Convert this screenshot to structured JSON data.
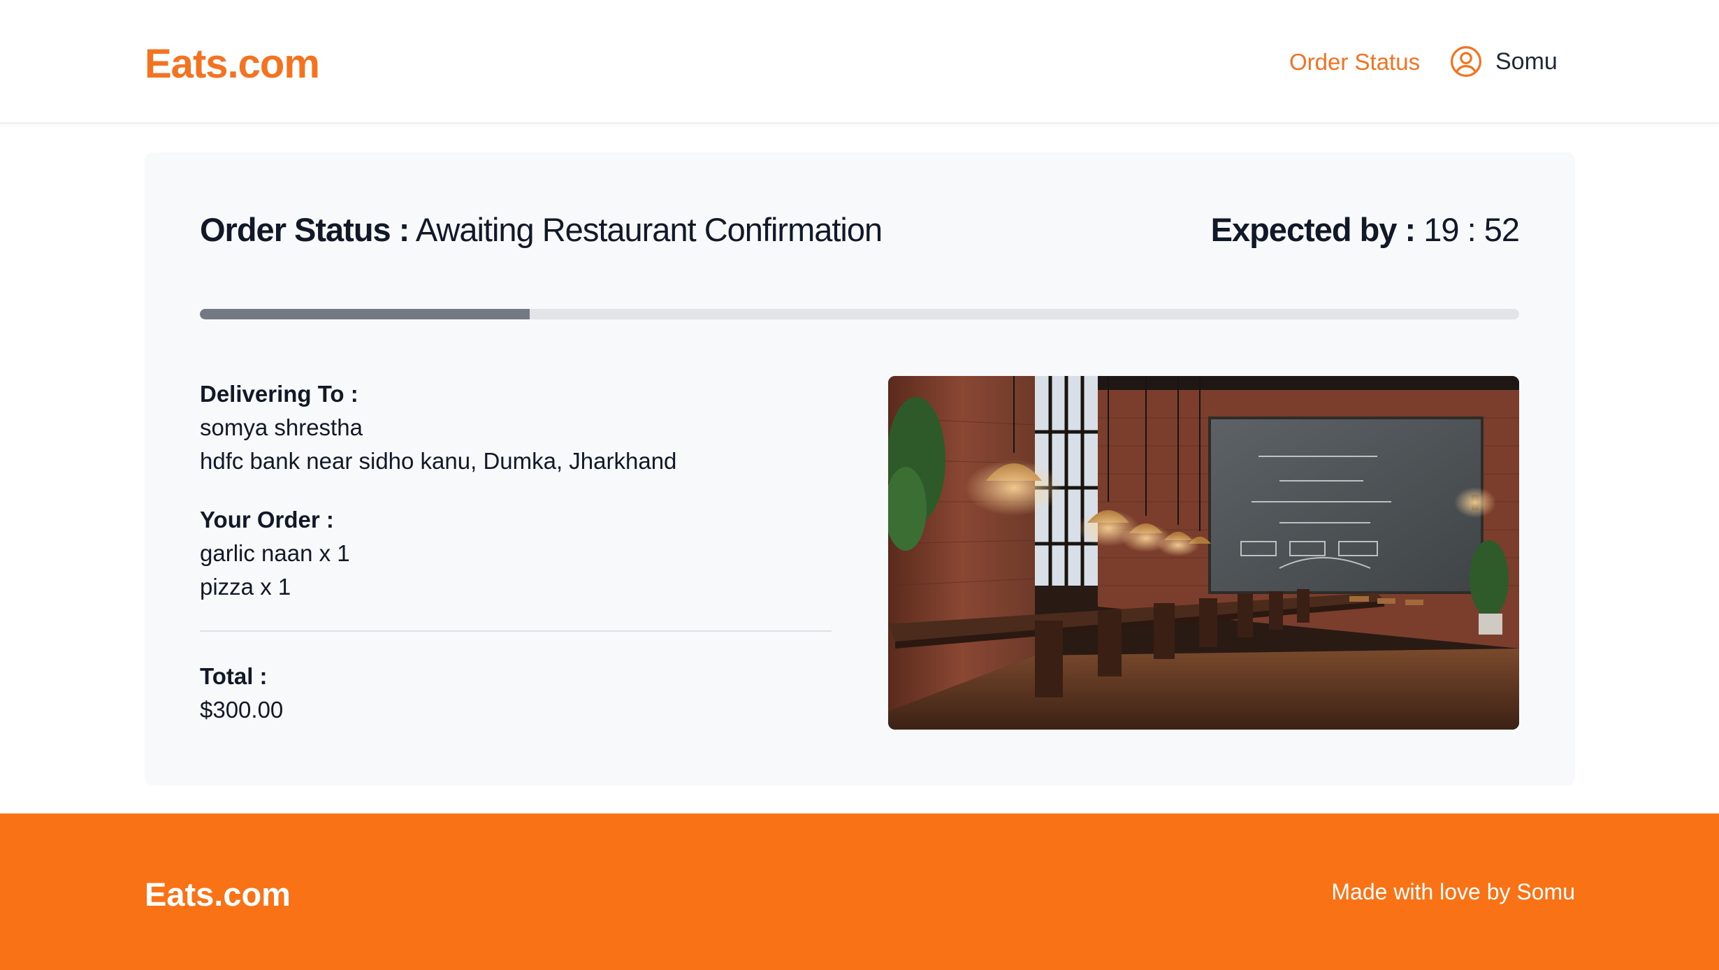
{
  "header": {
    "logo": "Eats.com",
    "nav_order_status": "Order Status",
    "user_name": "Somu",
    "user_icon": "user-circle-icon"
  },
  "order": {
    "status_label": "Order Status :",
    "status_value": "Awaiting Restaurant Confirmation",
    "expected_label": "Expected by :",
    "expected_value": "19 : 52",
    "progress_fraction": 0.25,
    "delivering_label": "Delivering To :",
    "recipient_name": "somya shrestha",
    "recipient_address": "hdfc bank near sidho kanu, Dumka, Jharkhand",
    "items_label": "Your Order :",
    "items": [
      "garlic naan x 1",
      "pizza x 1"
    ],
    "total_label": "Total :",
    "total_value": "$300.00"
  },
  "footer": {
    "logo": "Eats.com",
    "credit": "Made with love by Somu"
  },
  "colors": {
    "brand": "#f47321",
    "footer_bg": "#f97316",
    "card_bg": "#f8f9fb",
    "progress_fill": "#737982",
    "progress_track": "#e3e4e7"
  }
}
